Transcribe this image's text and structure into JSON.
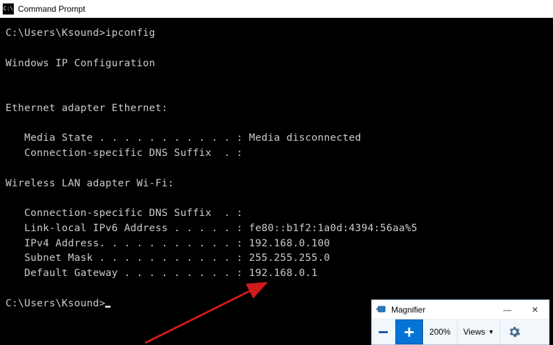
{
  "cmd": {
    "title": "Command Prompt",
    "lines": {
      "prompt1": "C:\\Users\\Ksound>ipconfig",
      "header": "Windows IP Configuration",
      "eth_title": "Ethernet adapter Ethernet:",
      "eth_media": "   Media State . . . . . . . . . . . : Media disconnected",
      "eth_dns": "   Connection-specific DNS Suffix  . :",
      "wifi_title": "Wireless LAN adapter Wi-Fi:",
      "wifi_dns": "   Connection-specific DNS Suffix  . :",
      "wifi_ipv6": "   Link-local IPv6 Address . . . . . : fe80::b1f2:1a0d:4394:56aa%5",
      "wifi_ipv4": "   IPv4 Address. . . . . . . . . . . : 192.168.0.100",
      "wifi_mask": "   Subnet Mask . . . . . . . . . . . : 255.255.255.0",
      "wifi_gw": "   Default Gateway . . . . . . . . . : 192.168.0.1",
      "prompt2": "C:\\Users\\Ksound>"
    }
  },
  "magnifier": {
    "title": "Magnifier",
    "zoom_level": "200%",
    "views_label": "Views",
    "minimize": "—",
    "close": "✕"
  },
  "colors": {
    "arrow": "#d11a1a",
    "mag_accent": "#0673d6"
  }
}
